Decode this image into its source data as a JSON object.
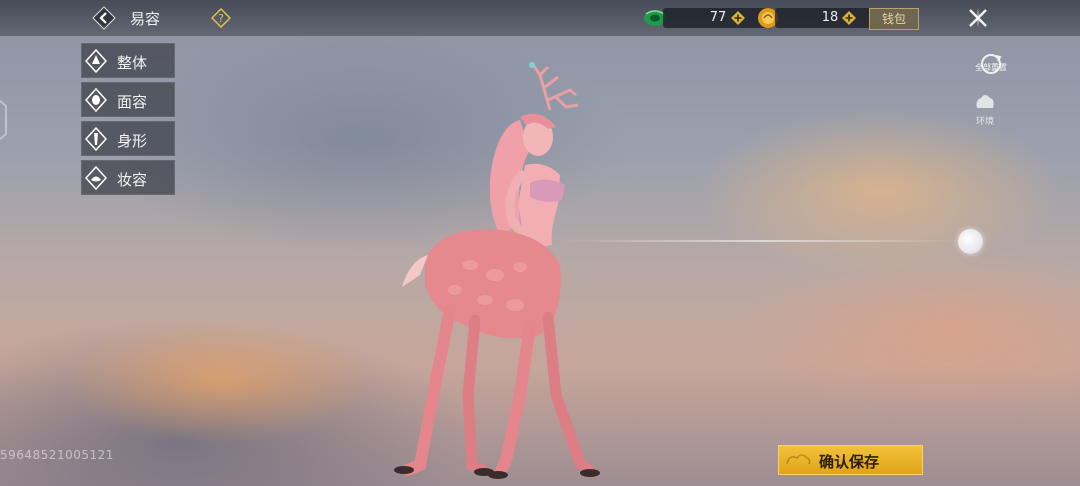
{
  "header": {
    "title": "易容",
    "back_icon": "chevron-left-icon",
    "help_icon": "question-diamond-icon",
    "close_icon": "close-x-icon"
  },
  "currencies": [
    {
      "name": "jade",
      "icon": "green-jade-icon",
      "value": "77",
      "color": "#1f9a4a"
    },
    {
      "name": "gold",
      "icon": "gold-ingot-icon",
      "value": "18",
      "color": "#e09a1a"
    }
  ],
  "wallet": {
    "label": "钱包"
  },
  "menu": {
    "items": [
      {
        "label": "整体",
        "icon": "whole-body-icon"
      },
      {
        "label": "面容",
        "icon": "face-icon"
      },
      {
        "label": "身形",
        "icon": "body-shape-icon"
      },
      {
        "label": "妆容",
        "icon": "makeup-icon"
      }
    ]
  },
  "side_tools": {
    "reset_all": {
      "label": "全部重置",
      "icon": "reset-icon"
    },
    "environment": {
      "label": "环境",
      "icon": "environment-icon"
    }
  },
  "footer": {
    "uid": "59648521005121",
    "confirm_label": "确认保存"
  },
  "colors": {
    "accent_gold": "#f2c13a",
    "panel_bg": "#3c3e46",
    "character_pink": "#e88a8e"
  }
}
